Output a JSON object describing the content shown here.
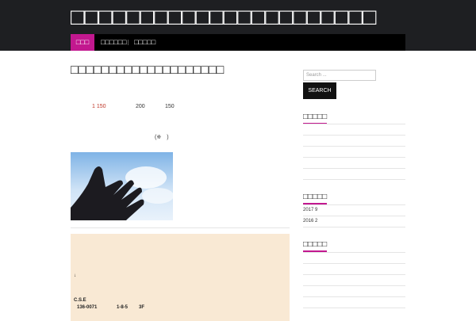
{
  "site": {
    "title": "□□□□□□□□□□□□□□□□□□□□□□"
  },
  "nav": {
    "items": [
      "□□□",
      "□□□□□□",
      "□□□□□"
    ]
  },
  "post": {
    "title": "□□□□□□□□□□□□□□□□□□□□",
    "meta_1": "1 150",
    "meta_2": "200",
    "meta_3": "150",
    "meta_note": "(※　)",
    "box": {
      "arrow": "↓",
      "company": "C.S.E",
      "zip": "136-0071",
      "address": "1-8-5",
      "floor": "3F"
    }
  },
  "sidebar": {
    "search_placeholder": "Search ...",
    "search_button": "SEARCH",
    "widget_titles": [
      "□□□□□",
      "□□□□□",
      "□□□□□"
    ],
    "archives": [
      "2017 9",
      "2016 2"
    ]
  },
  "colors": {
    "accent": "#c2188f",
    "header": "#1e1f22",
    "nav": "#000000",
    "box": "#f9e9d4"
  }
}
